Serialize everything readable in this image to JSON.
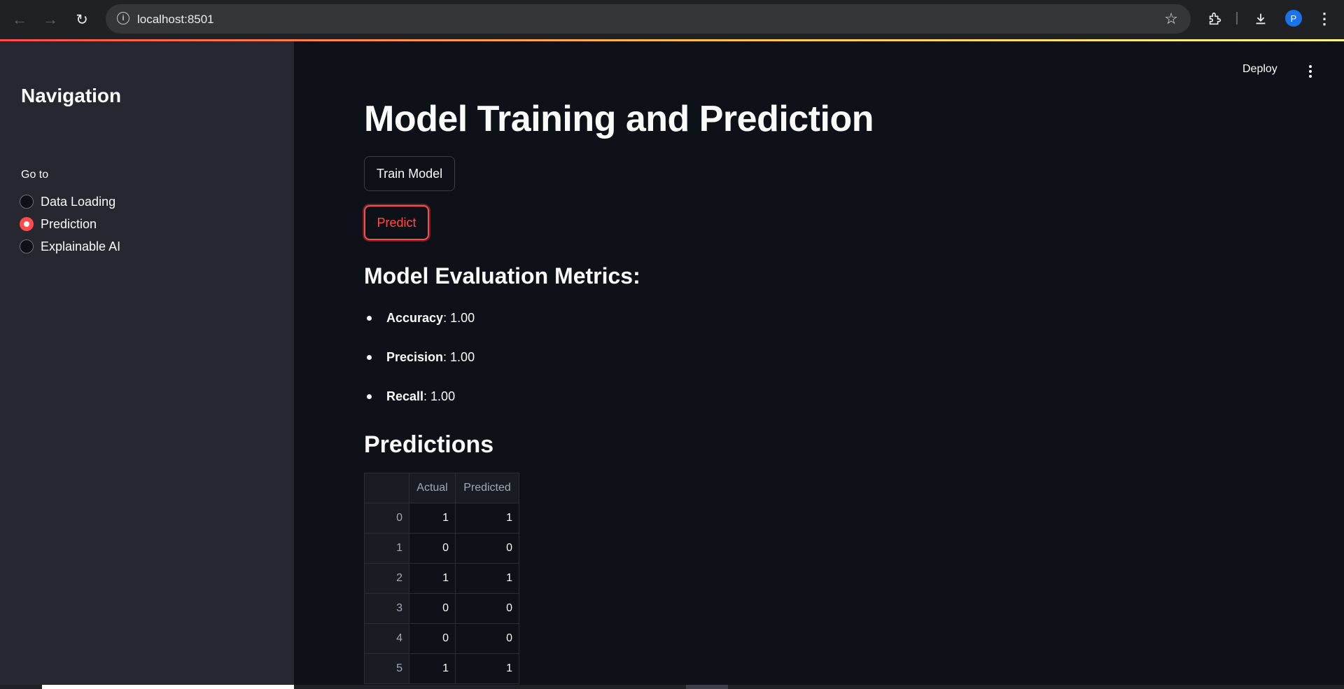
{
  "browser": {
    "url": "localhost:8501",
    "profile_initial": "P"
  },
  "sidebar": {
    "title": "Navigation",
    "radio_label": "Go to",
    "options": [
      {
        "label": "Data Loading",
        "selected": false
      },
      {
        "label": "Prediction",
        "selected": true
      },
      {
        "label": "Explainable AI",
        "selected": false
      }
    ]
  },
  "toolbar": {
    "deploy_label": "Deploy"
  },
  "main": {
    "title": "Model Training and Prediction",
    "train_button": "Train Model",
    "predict_button": "Predict",
    "metrics_heading": "Model Evaluation Metrics:",
    "metrics": [
      {
        "name": "Accuracy",
        "value": ": 1.00"
      },
      {
        "name": "Precision",
        "value": ": 1.00"
      },
      {
        "name": "Recall",
        "value": ": 1.00"
      }
    ],
    "predictions_heading": "Predictions",
    "table": {
      "headers": [
        "",
        "Actual",
        "Predicted"
      ],
      "rows": [
        [
          "0",
          "1",
          "1"
        ],
        [
          "1",
          "0",
          "0"
        ],
        [
          "2",
          "1",
          "1"
        ],
        [
          "3",
          "0",
          "0"
        ],
        [
          "4",
          "0",
          "0"
        ],
        [
          "5",
          "1",
          "1"
        ]
      ]
    }
  },
  "colors": {
    "accent": "#ff4b4b",
    "background": "#0e1117",
    "sidebar": "#262730"
  }
}
